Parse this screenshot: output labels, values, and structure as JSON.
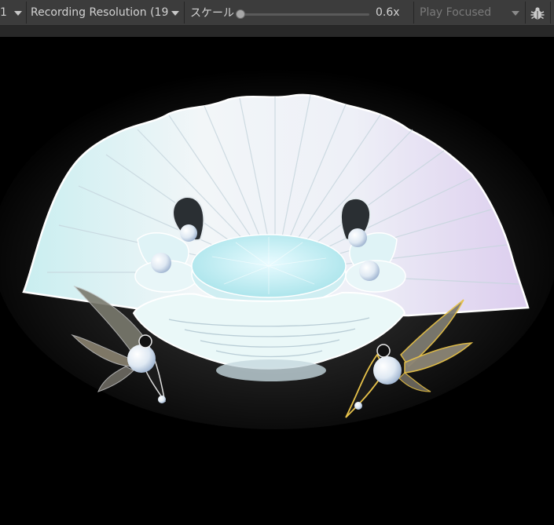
{
  "toolbar": {
    "display_fragment": "1",
    "resolution_label": "Recording Resolution (19",
    "scale_label": "スケール",
    "scale_value": "0.6x",
    "play_mode_label": "Play Focused",
    "bug_icon": "bug-icon"
  },
  "colors": {
    "toolbar_bg": "#3c3c3c",
    "viewport_bg": "#000000",
    "shell_tint_a": "#cfeef2",
    "shell_tint_b": "#e4d8f0",
    "gold_accent": "#e7c24a"
  }
}
